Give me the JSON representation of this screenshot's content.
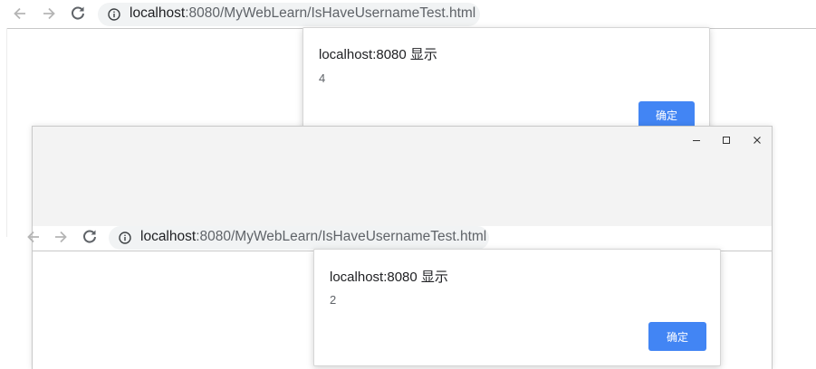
{
  "back_window": {
    "address": {
      "host": "localhost",
      "path": ":8080/MyWebLearn/IsHaveUsernameTest.html"
    },
    "dialog": {
      "title": "localhost:8080 显示",
      "message": "4",
      "ok_label": "确定"
    }
  },
  "front_window": {
    "address": {
      "host": "localhost",
      "path": ":8080/MyWebLearn/IsHaveUsernameTest.html"
    },
    "dialog": {
      "title": "localhost:8080 显示",
      "message": "2",
      "ok_label": "确定"
    }
  },
  "colors": {
    "accent": "#4285f4",
    "titlebar": "#f3f3f3",
    "omnibox": "#f1f3f4"
  },
  "icons": [
    "back-icon",
    "forward-icon",
    "reload-icon",
    "info-icon",
    "minimize-icon",
    "maximize-icon",
    "close-icon"
  ]
}
